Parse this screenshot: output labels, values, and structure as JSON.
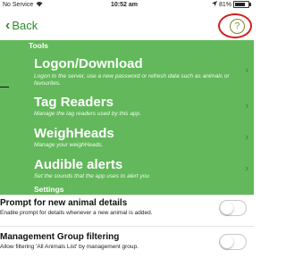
{
  "status_bar": {
    "carrier": "No Service",
    "time": "10:52 am",
    "battery_text": "81%",
    "battery_fraction": 0.81
  },
  "nav": {
    "back_label": "Back",
    "help_label": "?"
  },
  "tools": {
    "header": "Tools",
    "items": [
      {
        "title": "Logon/Download",
        "subtitle": "Logon to the server, use a new password or refresh data such as animals or favourites."
      },
      {
        "title": "Tag Readers",
        "subtitle": "Manage the tag readers used by this app."
      },
      {
        "title": "WeighHeads",
        "subtitle": "Manage your weighHeads."
      },
      {
        "title": "Audible alerts",
        "subtitle": "Set the sounds that the app uses to alert you"
      }
    ]
  },
  "settings": {
    "header": "Settings",
    "items": [
      {
        "title": "Prompt for new animal details",
        "description": "Enable prompt for details whenever a new animal is added.",
        "enabled": false
      },
      {
        "title": "Management Group filtering",
        "description": "Allow filtering 'All Animals List' by management group.",
        "enabled": false
      }
    ]
  },
  "colors": {
    "accent_green": "#62b85a",
    "back_green": "#2a8f2a",
    "highlight_red": "#d31e1e"
  }
}
